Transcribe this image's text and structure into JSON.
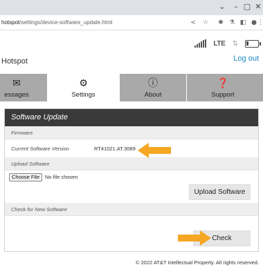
{
  "browser": {
    "url_host": "hotspot",
    "url_path": "/settings/device-software_update.html",
    "window_controls": [
      "chevron-down-icon",
      "minimize-icon",
      "restore-icon",
      "close-icon"
    ],
    "toolbar_icons": [
      "share-icon",
      "star-icon",
      "extensions-icon",
      "flask-icon",
      "sidebar-icon",
      "profile-icon",
      "menu-icon"
    ]
  },
  "header": {
    "title": "Hotspot",
    "logout": "Log out",
    "status": {
      "network": "LTE",
      "battery_level": 0.2
    }
  },
  "tabs": [
    {
      "label": "essages",
      "icon": "envelope-icon",
      "active": false
    },
    {
      "label": "Settings",
      "icon": "gear-icon",
      "active": true
    },
    {
      "label": "About",
      "icon": "info-icon",
      "active": false
    },
    {
      "label": "Support",
      "icon": "question-icon",
      "active": false
    }
  ],
  "panel": {
    "title": "Software Update",
    "firmware": {
      "section": "Firmware",
      "version_label": "Current Software Version",
      "version_value": "RT41021.AT.3089"
    },
    "upload": {
      "section": "Upload Software",
      "choose_file": "Choose File",
      "no_file": "No file chosen",
      "upload_button": "Upload Software"
    },
    "check": {
      "section": "Check for New Software",
      "check_button": "Check"
    }
  },
  "footer": "© 2022 AT&T Intellectual Property. All rights reserved.",
  "colors": {
    "accent": "#f5a623",
    "link": "#1a8ac9",
    "panel_header": "#3a3a3a",
    "tab_bar": "#a9a9a9"
  }
}
